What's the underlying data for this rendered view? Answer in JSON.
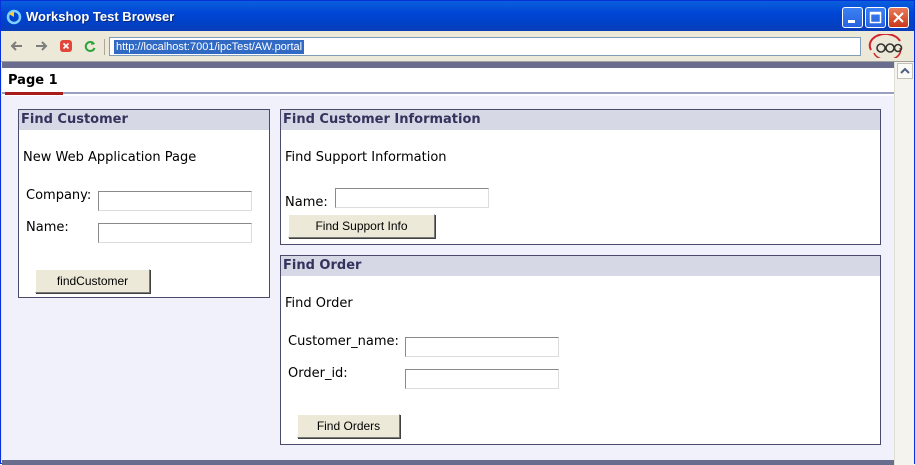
{
  "window": {
    "title": "Workshop Test Browser"
  },
  "toolbar": {
    "address": "http://localhost:7001/ipcTest/AW.portal"
  },
  "page": {
    "tab": "Page 1"
  },
  "find_customer": {
    "title": "Find Customer",
    "intro": "New Web Application Page",
    "company_label": "Company:",
    "name_label": "Name:",
    "button": "findCustomer"
  },
  "find_customer_info": {
    "title": "Find Customer Information",
    "intro": "Find Support Information",
    "name_label": "Name:",
    "button": "Find Support Info"
  },
  "find_order": {
    "title": "Find Order",
    "intro": "Find Order",
    "customer_label": "Customer_name:",
    "order_label": "Order_id:",
    "button": "Find Orders"
  },
  "colors": {
    "titlebar": "#0046d5",
    "portlet_header": "#d6d8e6",
    "tab_active": "#a81c1c"
  }
}
